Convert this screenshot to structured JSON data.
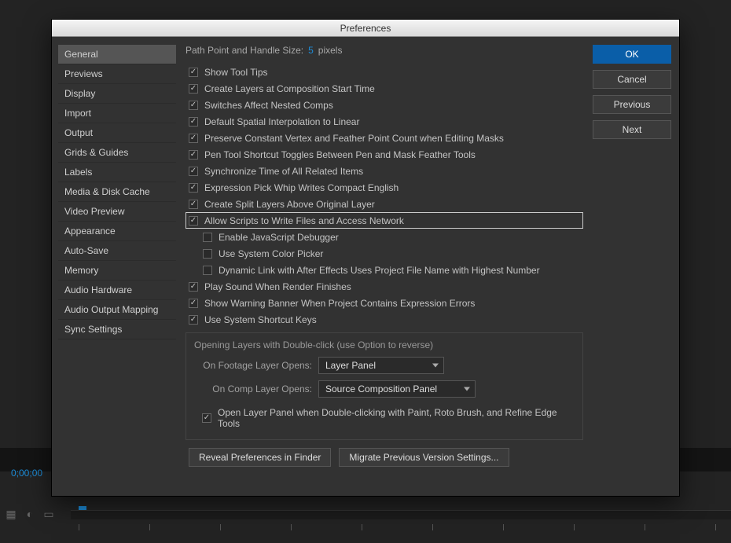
{
  "app_background": {
    "timecode": "0;00;00"
  },
  "dialog": {
    "title": "Preferences",
    "sidebar": [
      "General",
      "Previews",
      "Display",
      "Import",
      "Output",
      "Grids & Guides",
      "Labels",
      "Media & Disk Cache",
      "Video Preview",
      "Appearance",
      "Auto-Save",
      "Memory",
      "Audio Hardware",
      "Audio Output Mapping",
      "Sync Settings"
    ],
    "sidebar_selected": 0,
    "path_label": "Path Point and Handle Size:",
    "path_value": "5",
    "path_unit": "pixels",
    "checks": [
      {
        "label": "Show Tool Tips",
        "checked": true
      },
      {
        "label": "Create Layers at Composition Start Time",
        "checked": true
      },
      {
        "label": "Switches Affect Nested Comps",
        "checked": true
      },
      {
        "label": "Default Spatial Interpolation to Linear",
        "checked": true
      },
      {
        "label": "Preserve Constant Vertex and Feather Point Count when Editing Masks",
        "checked": true
      },
      {
        "label": "Pen Tool Shortcut Toggles Between Pen and Mask Feather Tools",
        "checked": true
      },
      {
        "label": "Synchronize Time of All Related Items",
        "checked": true
      },
      {
        "label": "Expression Pick Whip Writes Compact English",
        "checked": true
      },
      {
        "label": "Create Split Layers Above Original Layer",
        "checked": true
      },
      {
        "label": "Allow Scripts to Write Files and Access Network",
        "checked": true,
        "focused": true
      },
      {
        "label": "Enable JavaScript Debugger",
        "checked": false,
        "indent": 1
      },
      {
        "label": "Use System Color Picker",
        "checked": false,
        "indent": 1
      },
      {
        "label": "Dynamic Link with After Effects Uses Project File Name with Highest Number",
        "checked": false,
        "indent": 1
      },
      {
        "label": "Play Sound When Render Finishes",
        "checked": true
      },
      {
        "label": "Show Warning Banner When Project Contains Expression Errors",
        "checked": true
      },
      {
        "label": "Use System Shortcut Keys",
        "checked": true
      }
    ],
    "group": {
      "title": "Opening Layers with Double-click (use Option to reverse)",
      "row1_label": "On Footage Layer Opens:",
      "row1_value": "Layer Panel",
      "row2_label": "On Comp Layer Opens:",
      "row2_value": "Source Composition Panel",
      "inner_check": {
        "label": "Open Layer Panel when Double-clicking with Paint, Roto Brush, and Refine Edge Tools",
        "checked": true
      }
    },
    "bottom_buttons": [
      "Reveal Preferences in Finder",
      "Migrate Previous Version Settings..."
    ],
    "right_buttons": [
      "OK",
      "Cancel",
      "Previous",
      "Next"
    ]
  }
}
